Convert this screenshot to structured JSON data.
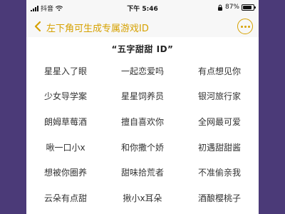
{
  "status_bar": {
    "app_back_label": "抖音",
    "time": "下午 5:46",
    "battery_percent": "87%"
  },
  "header": {
    "title": "左下角可生成专属游戏ID",
    "back_icon": "chevron-left-icon",
    "more_icon": "more-dots-icon"
  },
  "section": {
    "title": "“五字甜甜 ID”"
  },
  "names": [
    [
      "星星入了眼",
      "一起恋爱吗",
      "有点想见你"
    ],
    [
      "少女导学案",
      "星星饲养员",
      "银河旅行家"
    ],
    [
      "朗姆草莓酒",
      "擅自喜欢你",
      "全网最可爱"
    ],
    [
      "啾一口小x",
      "和你撒个娇",
      "初遇甜甜酱"
    ],
    [
      "想被你圈养",
      "甜味拾荒者",
      "不准偷亲我"
    ],
    [
      "云朵有点甜",
      "揪小x耳朵",
      "酒酿樱桃子"
    ]
  ],
  "colors": {
    "accent": "#d6a100",
    "background": "#4b3a78"
  }
}
